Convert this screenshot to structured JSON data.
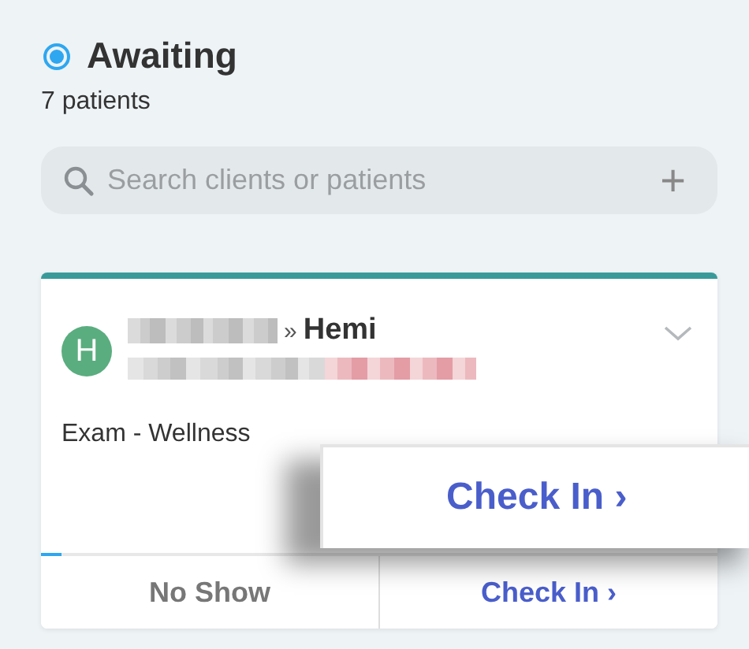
{
  "status": {
    "label": "Awaiting",
    "selected": true,
    "count": "7 patients"
  },
  "search": {
    "placeholder": "Search clients or patients",
    "add": "+"
  },
  "card": {
    "initial": "H",
    "separator": "»",
    "patient": "Hemi",
    "service": "Exam - Wellness",
    "level": 0.03,
    "actions": [
      {
        "label": "No Show",
        "kind": "secondary"
      },
      {
        "label": "Check In ›",
        "kind": "primary"
      }
    ]
  },
  "popup": {
    "label": "Check In ›"
  }
}
